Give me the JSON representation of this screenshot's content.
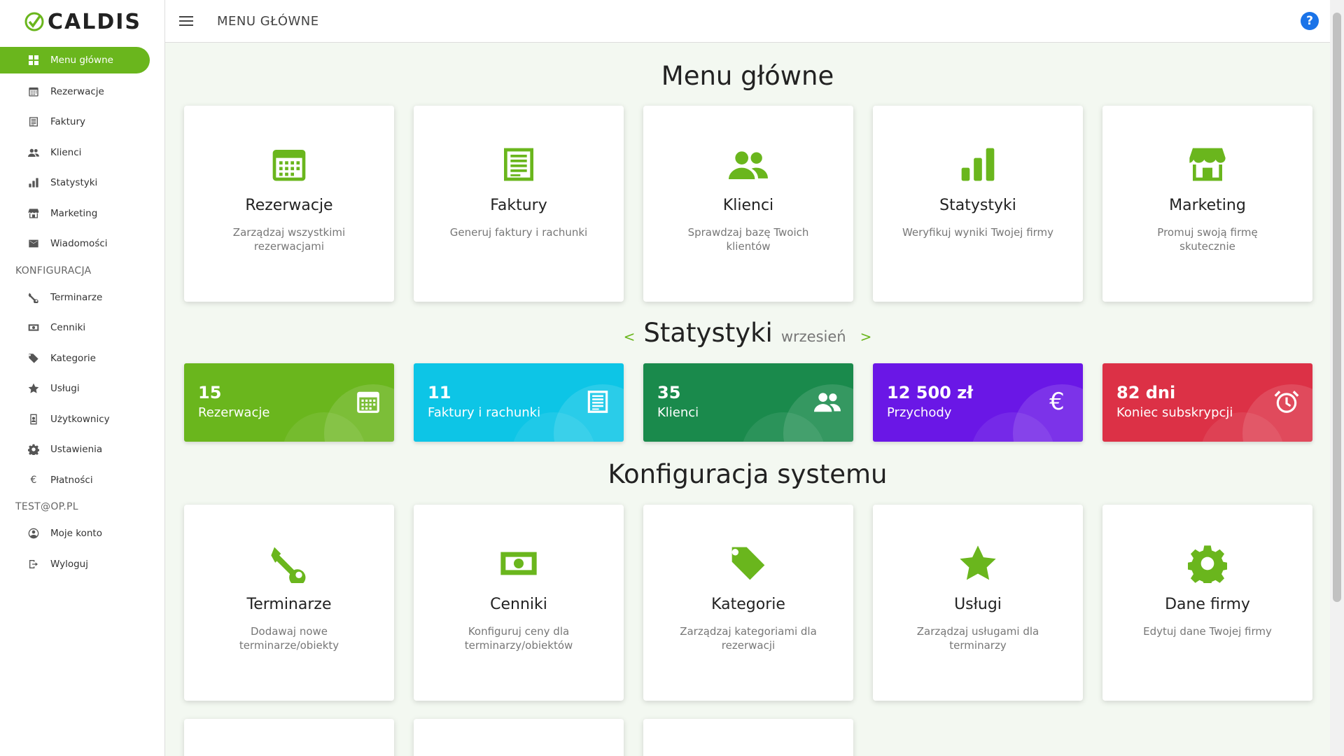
{
  "app": {
    "logo_text": "CALDIS"
  },
  "sidebar": {
    "items": [
      {
        "label": "Menu główne",
        "icon": "grid-icon",
        "active": true
      },
      {
        "label": "Rezerwacje",
        "icon": "calendar-icon"
      },
      {
        "label": "Faktury",
        "icon": "invoice-icon"
      },
      {
        "label": "Klienci",
        "icon": "users-icon"
      },
      {
        "label": "Statystyki",
        "icon": "bar-chart-icon"
      },
      {
        "label": "Marketing",
        "icon": "store-icon"
      },
      {
        "label": "Wiadomości",
        "icon": "envelope-icon"
      }
    ],
    "config_section": "KONFIGURACJA",
    "config_items": [
      {
        "label": "Terminarze",
        "icon": "wrench-icon"
      },
      {
        "label": "Cenniki",
        "icon": "money-icon"
      },
      {
        "label": "Kategorie",
        "icon": "tag-icon"
      },
      {
        "label": "Usługi",
        "icon": "star-icon"
      },
      {
        "label": "Użytkownicy",
        "icon": "user-badge-icon"
      },
      {
        "label": "Ustawienia",
        "icon": "gear-icon"
      },
      {
        "label": "Płatności",
        "icon": "euro-icon"
      }
    ],
    "account_section": "TEST@OP.PL",
    "account_items": [
      {
        "label": "Moje konto",
        "icon": "user-circle-icon"
      },
      {
        "label": "Wyloguj",
        "icon": "logout-icon"
      }
    ]
  },
  "header": {
    "title": "MENU GŁÓWNE",
    "help": "?"
  },
  "main": {
    "title": "Menu główne",
    "cards": [
      {
        "title": "Rezerwacje",
        "desc": "Zarządzaj wszystkimi rezerwacjami",
        "icon": "calendar-icon"
      },
      {
        "title": "Faktury",
        "desc": "Generuj faktury i rachunki",
        "icon": "invoice-icon"
      },
      {
        "title": "Klienci",
        "desc": "Sprawdzaj bazę Twoich klientów",
        "icon": "users-icon"
      },
      {
        "title": "Statystyki",
        "desc": "Weryfikuj wyniki Twojej firmy",
        "icon": "bar-chart-icon"
      },
      {
        "title": "Marketing",
        "desc": "Promuj swoją firmę skutecznie",
        "icon": "store-icon"
      }
    ]
  },
  "stats": {
    "title": "Statystyki",
    "month": "wrzesień",
    "prev": "<",
    "next": ">",
    "cards": [
      {
        "value": "15",
        "label": "Rezerwacje",
        "color": "#6ab61d",
        "icon": "calendar-icon"
      },
      {
        "value": "11",
        "label": "Faktury i rachunki",
        "color": "#0dc5e6",
        "icon": "invoice-icon"
      },
      {
        "value": "35",
        "label": "Klienci",
        "color": "#1a8a4c",
        "icon": "users-icon"
      },
      {
        "value": "12 500 zł",
        "label": "Przychody",
        "color": "#6a17e6",
        "icon": "euro-icon"
      },
      {
        "value": "82 dni",
        "label": "Koniec subskrypcji",
        "color": "#dc3146",
        "icon": "alarm-icon"
      }
    ]
  },
  "config": {
    "title": "Konfiguracja systemu",
    "cards": [
      {
        "title": "Terminarze",
        "desc": "Dodawaj nowe terminarze/obiekty",
        "icon": "wrench-icon"
      },
      {
        "title": "Cenniki",
        "desc": "Konfiguruj ceny dla terminarzy/obiektów",
        "icon": "money-icon"
      },
      {
        "title": "Kategorie",
        "desc": "Zarządzaj kategoriami dla rezerwacji",
        "icon": "tag-icon"
      },
      {
        "title": "Usługi",
        "desc": "Zarządzaj usługami dla terminarzy",
        "icon": "star-icon"
      },
      {
        "title": "Dane firmy",
        "desc": "Edytuj dane Twojej firmy",
        "icon": "gear-icon"
      }
    ]
  },
  "euro_symbol": "€"
}
